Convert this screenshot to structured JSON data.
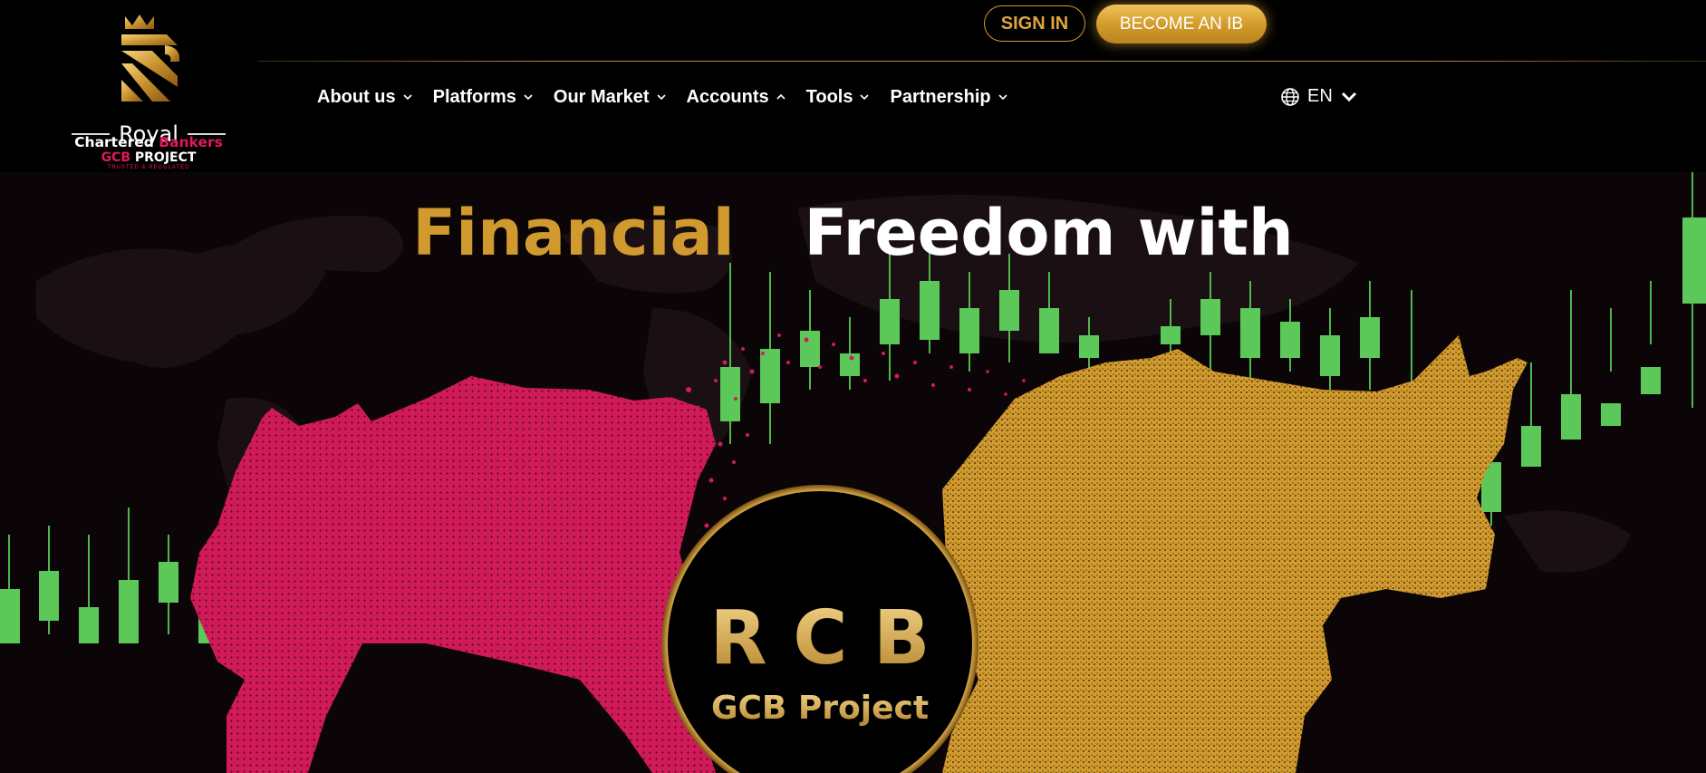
{
  "logo": {
    "royal": "Royal",
    "chartered": "Chartered",
    "bankers": "Bankers",
    "gcb": "GCB",
    "project": "PROJECT",
    "tagline": "TRUSTED & REGULATED"
  },
  "header": {
    "signin_label": "SIGN IN",
    "become_ib_label": "BECOME AN IB"
  },
  "nav": {
    "items": [
      {
        "label": "About us",
        "icon": "chevron-down-icon"
      },
      {
        "label": "Platforms",
        "icon": "chevron-down-icon"
      },
      {
        "label": "Our Market",
        "icon": "chevron-down-icon"
      },
      {
        "label": "Accounts",
        "icon": "chevron-up-icon"
      },
      {
        "label": "Tools",
        "icon": "chevron-down-icon"
      },
      {
        "label": "Partnership",
        "icon": "chevron-down-icon"
      }
    ]
  },
  "language": {
    "label": "EN",
    "icon": "globe-icon"
  },
  "hero": {
    "title_gold": "Financial",
    "title_white": "Freedom with",
    "badge_main": "R C B",
    "badge_sub": "GCB Project"
  },
  "colors": {
    "gold": "#d19a2e",
    "pink": "#d11a5a",
    "green": "#5cc85a",
    "background": "#000000"
  }
}
